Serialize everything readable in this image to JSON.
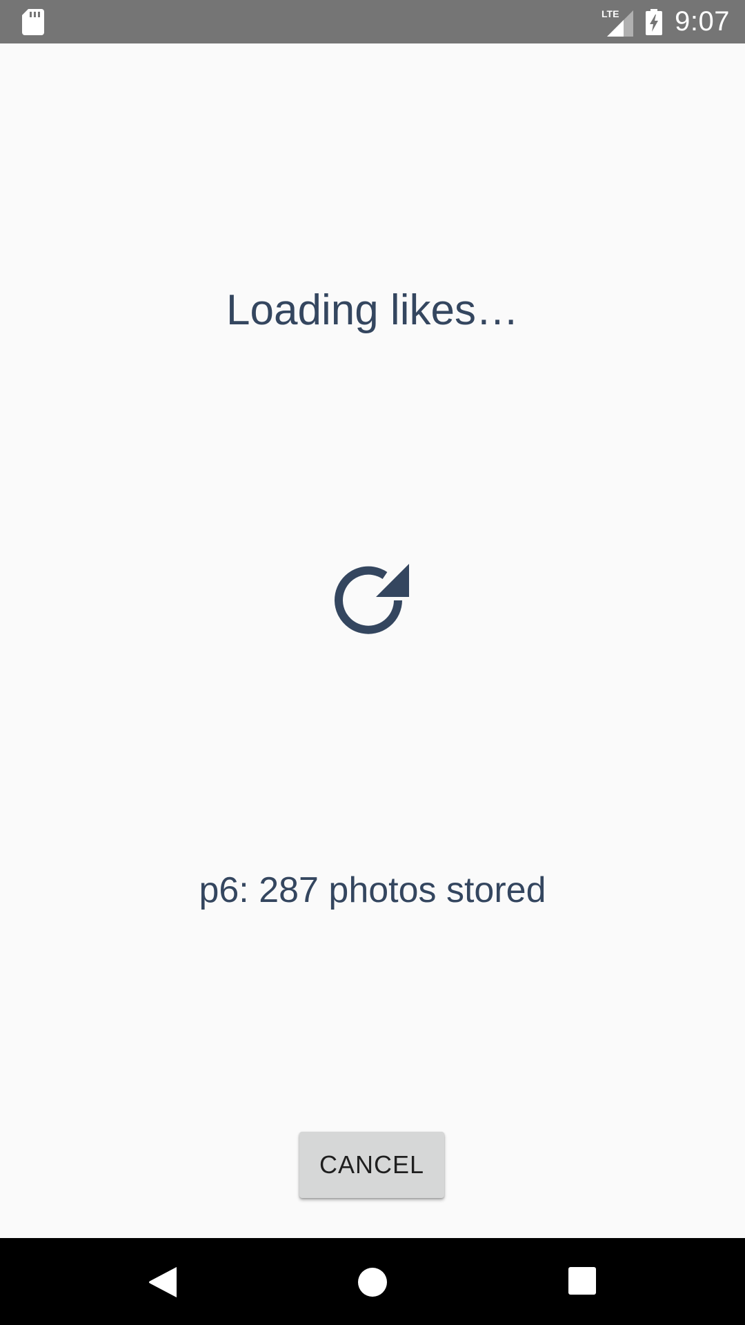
{
  "status_bar": {
    "time": "9:07",
    "network": "LTE",
    "icons": [
      "sd-card-icon",
      "lte-signal-icon",
      "battery-charging-icon"
    ]
  },
  "loading": {
    "title": "Loading likes…",
    "icon": "refresh-icon"
  },
  "progress": {
    "status_text": "p6: 287 photos stored"
  },
  "actions": {
    "cancel_label": "CANCEL"
  },
  "nav_bar": {
    "icons": [
      "back-icon",
      "home-icon",
      "recents-icon"
    ]
  },
  "colors": {
    "text_primary": "#34465f",
    "background": "#fafafa",
    "status_bar": "#757575",
    "button_bg": "#d6d7d7",
    "nav_bar": "#000000"
  }
}
